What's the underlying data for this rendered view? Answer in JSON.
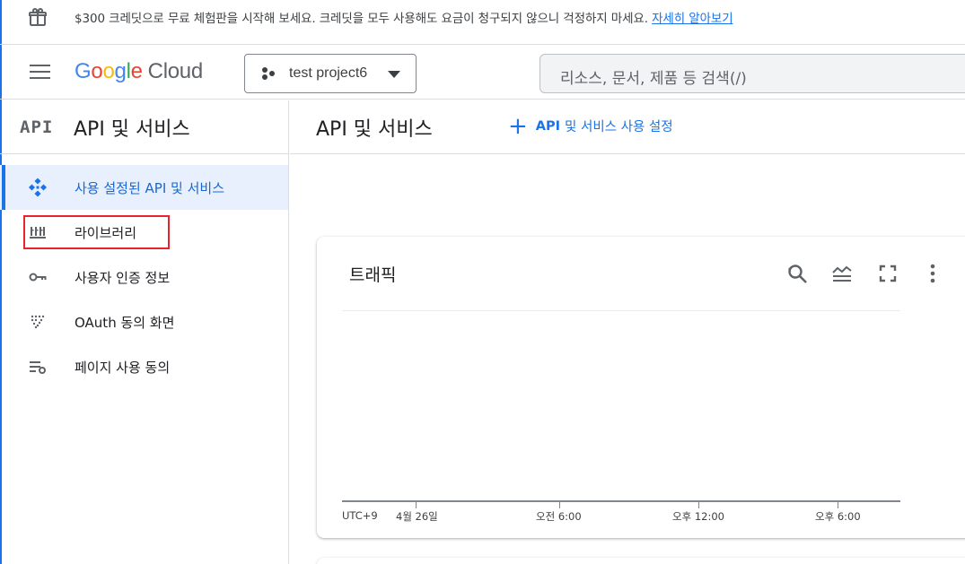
{
  "banner": {
    "message": "$300 크레딧으로 무료 체험판을 시작해 보세요. 크레딧을 모두 사용해도 요금이 청구되지 않으니 걱정하지 마세요.",
    "link": "자세히 알아보기"
  },
  "header": {
    "logo_google": [
      "G",
      "o",
      "o",
      "g",
      "l",
      "e"
    ],
    "logo_cloud": "Cloud",
    "project_name": "test project6",
    "search_placeholder": "리소스, 문서, 제품 등 검색(/)"
  },
  "sidebar": {
    "icon_text": "API",
    "title": "API 및 서비스",
    "items": [
      {
        "label": "사용 설정된 API 및 서비스",
        "icon": "diamond-dots-icon",
        "active": true
      },
      {
        "label": "라이브러리",
        "icon": "library-icon",
        "active": false
      },
      {
        "label": "사용자 인증 정보",
        "icon": "key-icon",
        "active": false
      },
      {
        "label": "OAuth 동의 화면",
        "icon": "dotted-grid-icon",
        "active": false
      },
      {
        "label": "페이지 사용 동의",
        "icon": "settings-list-icon",
        "active": false
      }
    ]
  },
  "main": {
    "title": "API 및 서비스",
    "enable_button": {
      "api": "API",
      "rest": "및 서비스 사용 설정"
    },
    "traffic_card": {
      "title": "트래픽",
      "tools": [
        "reset-zoom-icon",
        "legend-icon",
        "fullscreen-icon",
        "more-vert-icon"
      ],
      "axis_labels": [
        "UTC+9",
        "4월 26일",
        "오전 6:00",
        "오후 12:00",
        "오후 6:00"
      ]
    }
  },
  "colors": {
    "accent": "#1a73e8",
    "active_bg": "#e8f0fe",
    "highlight_box": "#e8222e"
  }
}
